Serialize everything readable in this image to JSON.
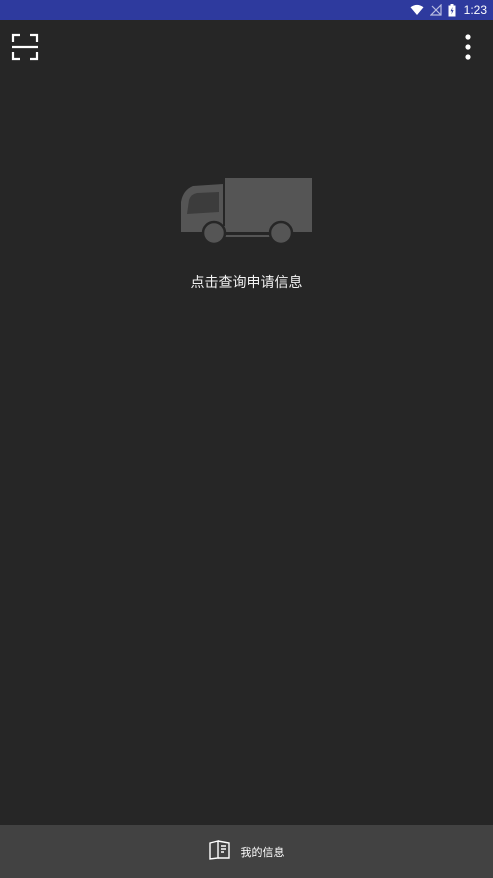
{
  "status_bar": {
    "time": "1:23",
    "icons": [
      "wifi-icon",
      "no-signal-icon",
      "battery-charging-icon"
    ]
  },
  "toolbar": {
    "left_icon": "scan-icon",
    "right_icon": "more-vert-icon"
  },
  "empty_state": {
    "icon": "truck-icon",
    "message": "点击查询申请信息"
  },
  "bottom_nav": {
    "items": [
      {
        "icon": "book-icon",
        "label": "我的信息"
      }
    ]
  },
  "colors": {
    "status_bar": "#2e3a9e",
    "background": "#262626",
    "bottom_bar": "#424242",
    "illustration": "#555555"
  }
}
